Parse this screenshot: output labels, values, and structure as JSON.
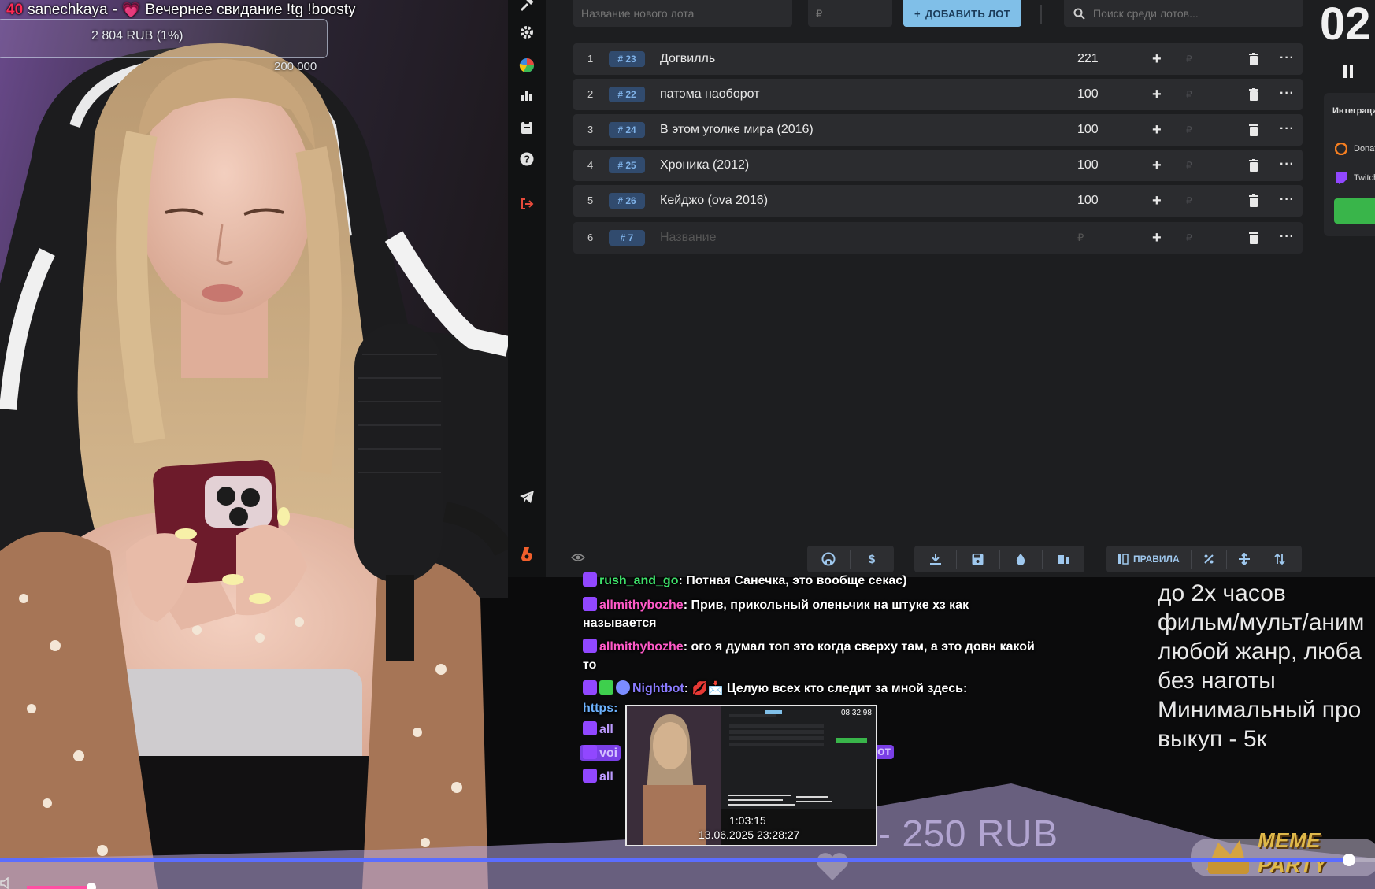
{
  "overlay": {
    "count": "40",
    "channel": "sanechkaya",
    "separator": "-",
    "heart": "💗",
    "title": "Вечернее свидание !tg !boosty",
    "goal_amount": "2 804 RUB (1%)",
    "goal_target": "200 000"
  },
  "auction": {
    "lot_name_placeholder": "Название нового лота",
    "lot_price_placeholder": "₽",
    "add_button_icon": "+",
    "add_button_label": "ДОБАВИТЬ ЛОТ",
    "search_placeholder": "Поиск среди лотов...",
    "rub_symbol": "₽",
    "plus_symbol": "+",
    "more_symbol": "···",
    "lots": [
      {
        "index": "1",
        "id": "# 23",
        "name": "Догвилль",
        "amount": "221"
      },
      {
        "index": "2",
        "id": "# 22",
        "name": "патэма наоборот",
        "amount": "100"
      },
      {
        "index": "3",
        "id": "# 24",
        "name": "В этом уголке мира (2016)",
        "amount": "100"
      },
      {
        "index": "4",
        "id": "# 25",
        "name": "Хроника (2012)",
        "amount": "100"
      },
      {
        "index": "5",
        "id": "# 26",
        "name": "Кейджо (ova 2016)",
        "amount": "100"
      }
    ],
    "empty_lot": {
      "index": "6",
      "id": "# 7",
      "name": "Название",
      "amount": "₽"
    },
    "rules_label": "ПРАВИЛА",
    "timer": "02",
    "integrations_title": "Интеграции",
    "integration_1": "Donation",
    "integration_2": "Twitch"
  },
  "chat": {
    "l1_user": "rush_and_go",
    "l1_text": ": Потная Санечка, это вообще секас)",
    "l2_user": "allmithybozhe",
    "l2_text": ": Прив, прикольный оленьчик на штуке хз как",
    "l2_cont": "называется",
    "l3_user": "allmithybozhe",
    "l3_text": ": ого я думал топ это когда сверху там, а это довн какой",
    "l3_cont": "то",
    "l4_user": "Nightbot",
    "l4_text": ": 💋📩 Целую всех кто следит за мной здесь:",
    "l5_link": "https:",
    "frag1": "all",
    "frag2": "voi",
    "frag3": "all",
    "frag_right": "от",
    "colors": {
      "green_user": "#3ee06a",
      "pink_user": "#ff5ac8",
      "purple_user": "#8a7bff"
    }
  },
  "rules": {
    "line1": "до 2х часов",
    "line2": "фильм/мульт/аним",
    "line3": "любой жанр, люба",
    "line4": "без наготы",
    "line5": "Минимальный про",
    "line6": "выкуп - 5к"
  },
  "donation": {
    "amount": "- 250 RUB"
  },
  "meme": {
    "label": "MEME PARTY"
  },
  "player": {
    "progress": 0.982,
    "volume": 0.9,
    "preview_time": "1:03:15",
    "preview_date": "13.06.2025 23:28:27",
    "preview_clock": "08:32:98"
  }
}
